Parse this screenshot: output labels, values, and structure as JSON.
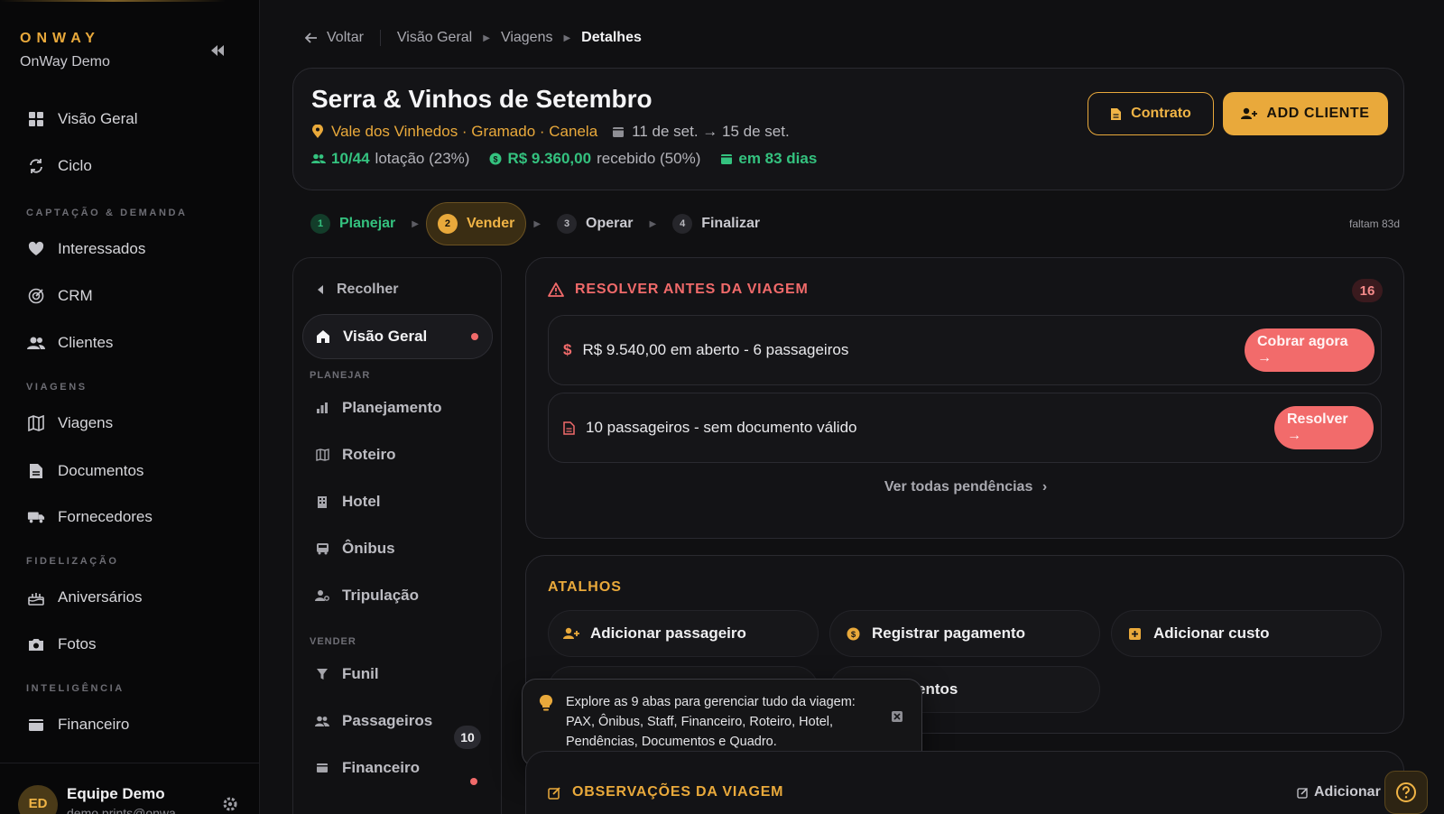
{
  "sidebar": {
    "brand": "ONWAY",
    "workspace": "OnWay Demo",
    "sections": {
      "captacao": "CAPTAÇÃO & DEMANDA",
      "viagens": "VIAGENS",
      "fidelizacao": "FIDELIZAÇÃO",
      "inteligencia": "INTELIGÊNCIA"
    },
    "items": {
      "visao_geral": "Visão Geral",
      "ciclo": "Ciclo",
      "interessados": "Interessados",
      "crm": "CRM",
      "clientes": "Clientes",
      "viagens": "Viagens",
      "documentos": "Documentos",
      "fornecedores": "Fornecedores",
      "aniversarios": "Aniversários",
      "fotos": "Fotos",
      "financeiro": "Financeiro"
    },
    "user": {
      "initials": "ED",
      "name": "Equipe Demo",
      "email": "demo.prints@onwa"
    }
  },
  "breadcrumb": {
    "back": "Voltar",
    "items": [
      "Visão Geral",
      "Viagens"
    ],
    "current": "Detalhes"
  },
  "trip": {
    "title": "Serra & Vinhos de Setembro",
    "location": "Vale dos Vinhedos · Gramado · Canela",
    "dates": "11 de set. → 15 de set.",
    "occupancy_value": "10/44",
    "occupancy_label": "lotação (23%)",
    "received_value": "R$ 9.360,00",
    "received_label": "recebido (50%)",
    "countdown": "em 83 dias",
    "btn_contrato": "Contrato",
    "btn_add_cliente": "ADD CLIENTE"
  },
  "steps": [
    {
      "num": "1",
      "label": "Planejar",
      "state": "done"
    },
    {
      "num": "2",
      "label": "Vender",
      "state": "active"
    },
    {
      "num": "3",
      "label": "Operar",
      "state": "todo"
    },
    {
      "num": "4",
      "label": "Finalizar",
      "state": "todo"
    }
  ],
  "faltam": "faltam 83d",
  "subnav": {
    "collapse": "Recolher",
    "active": "Visão Geral",
    "section_planejar": "PLANEJAR",
    "section_vender": "VENDER",
    "items": {
      "planejamento": "Planejamento",
      "roteiro": "Roteiro",
      "hotel": "Hotel",
      "onibus": "Ônibus",
      "tripulacao": "Tripulação",
      "funil": "Funil",
      "passageiros": "Passageiros",
      "financeiro": "Financeiro"
    },
    "passageiros_count": "10"
  },
  "resolve": {
    "title": "RESOLVER ANTES DA VIAGEM",
    "count": "16",
    "issue1_text": "R$ 9.540,00 em aberto - 6 passageiros",
    "issue1_btn": "Cobrar agora →",
    "issue2_text": "10 passageiros - sem documento válido",
    "issue2_btn": "Resolver →",
    "see_all": "Ver todas pendências"
  },
  "atalhos": {
    "title": "ATALHOS",
    "add_passageiro": "Adicionar passageiro",
    "registrar_pagamento": "Registrar pagamento",
    "adicionar_custo": "Adicionar custo",
    "documentos_partial": "entos"
  },
  "tooltip": {
    "text": "Explore as 9 abas para gerenciar tudo da viagem: PAX, Ônibus, Staff, Financeiro, Roteiro, Hotel, Pendências, Documentos e Quadro."
  },
  "obs": {
    "title": "OBSERVAÇÕES DA VIAGEM",
    "add": "Adicionar"
  },
  "colors": {
    "accent": "#e9a93b",
    "success": "#34c27f",
    "danger": "#f26b6b",
    "background": "#101012"
  }
}
